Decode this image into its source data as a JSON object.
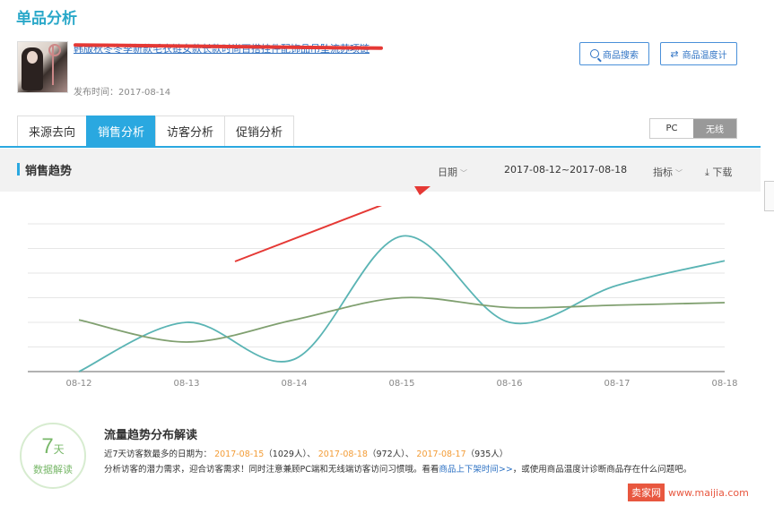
{
  "page": {
    "title": "单品分析"
  },
  "product": {
    "title": "韩版秋冬冬季新款毛衣链女款长款时尚百搭挂件配饰品吊坠流苏项链",
    "publish_date": "发布时间：2017-08-14"
  },
  "buttons": {
    "search": "商品搜索",
    "temperature": "商品温度计"
  },
  "tabs": [
    {
      "label": "来源去向",
      "active": false
    },
    {
      "label": "销售分析",
      "active": true
    },
    {
      "label": "访客分析",
      "active": false
    },
    {
      "label": "促销分析",
      "active": false
    }
  ],
  "device_toggle": {
    "pc": "PC",
    "wireless": "无线",
    "selected": "无线"
  },
  "trend": {
    "title": "销售趋势",
    "date_label": "日期",
    "date_range": "2017-08-12~2017-08-18",
    "metric_label": "指标",
    "download_label": "下载"
  },
  "chart_data": {
    "type": "line",
    "categories": [
      "08-12",
      "08-13",
      "08-14",
      "08-15",
      "08-16",
      "08-17",
      "08-18"
    ],
    "series": [
      {
        "color": "#5ab4b4",
        "values": [
          0,
          2.0,
          0.5,
          5.5,
          2.0,
          3.5,
          4.5
        ]
      },
      {
        "color": "#80a070",
        "values": [
          2.1,
          1.2,
          2.1,
          3.0,
          2.6,
          2.7,
          2.8
        ]
      }
    ],
    "ylim": [
      0,
      6
    ],
    "grid": true
  },
  "summary": {
    "badge_num": "7",
    "badge_unit": "天",
    "badge_label": "数据解读",
    "title": "流量趋势分布解读",
    "line1_prefix": "近7天访客数最多的日期为：",
    "date1": "2017-08-15",
    "count1": "（1029人）、",
    "date2": "2017-08-18",
    "count2": "（972人）、",
    "date3": "2017-08-17",
    "count3": "（935人）",
    "line2_prefix": "分析访客的潜力需求，迎合访客需求！同时注意兼顾PC端和无线端访客访问习惯哦。看看",
    "line2_link": "商品上下架时间>>",
    "line2_suffix": "，或使用商品温度计诊断商品存在什么问题吧。"
  },
  "watermark": {
    "logo": "卖家网",
    "site": "www.maijia.com"
  },
  "annotation_color": "#e53935"
}
